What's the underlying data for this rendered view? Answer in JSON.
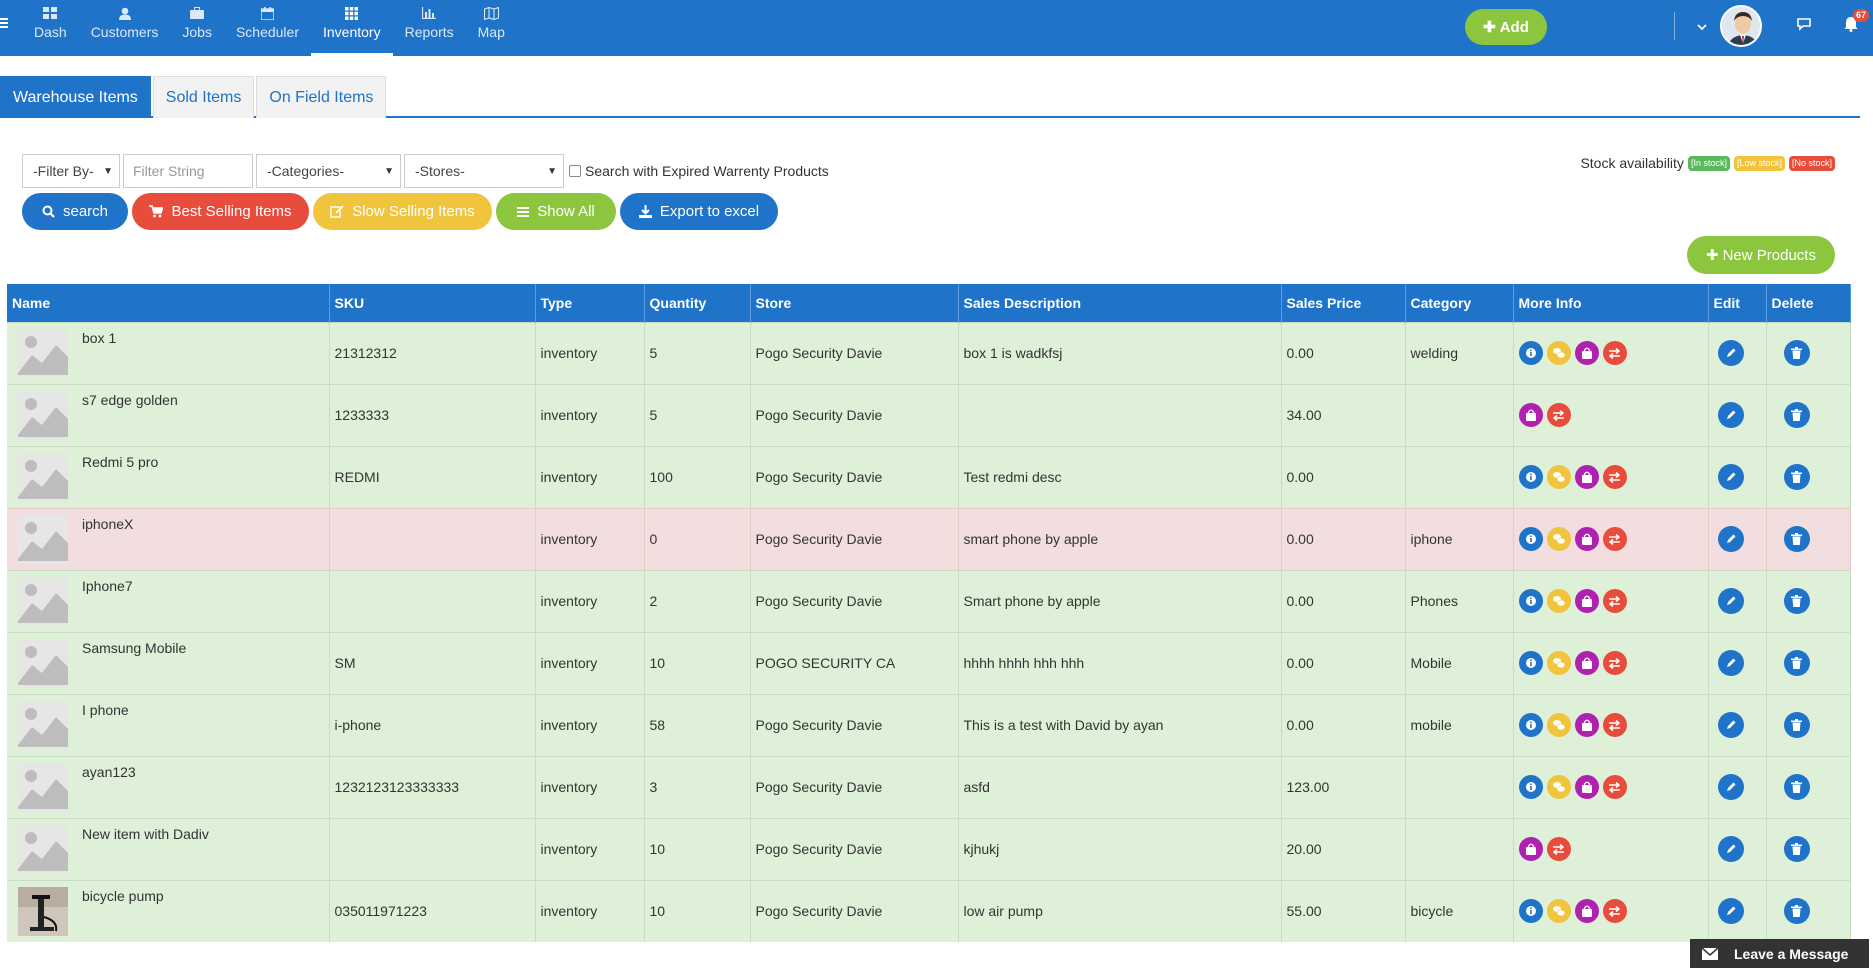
{
  "nav": {
    "items": [
      {
        "label": "Dash",
        "icon": "dashboard-icon",
        "active": false
      },
      {
        "label": "Customers",
        "icon": "user-icon",
        "active": false
      },
      {
        "label": "Jobs",
        "icon": "briefcase-icon",
        "active": false
      },
      {
        "label": "Scheduler",
        "icon": "calendar-icon",
        "active": false
      },
      {
        "label": "Inventory",
        "icon": "grid-icon",
        "active": true
      },
      {
        "label": "Reports",
        "icon": "bar-chart-icon",
        "active": false
      },
      {
        "label": "Map",
        "icon": "map-icon",
        "active": false
      }
    ],
    "add_label": "Add",
    "notification_count": "67"
  },
  "tabs": [
    {
      "label": "Warehouse Items",
      "active": true
    },
    {
      "label": "Sold Items",
      "active": false
    },
    {
      "label": "On Field Items",
      "active": false
    }
  ],
  "filters": {
    "filter_by": "-Filter By-",
    "filter_string_placeholder": "Filter String",
    "categories": "-Categories-",
    "stores": "-Stores-",
    "expired_label": "Search with Expired Warrenty Products"
  },
  "buttons": {
    "search": "search",
    "best_selling": "Best Selling Items",
    "slow_selling": "Slow Selling Items",
    "show_all": "Show All",
    "export": "Export to excel",
    "new_products": "New Products"
  },
  "stock": {
    "label": "Stock availability",
    "in": "[In stock]",
    "low": "[Low stock]",
    "none": "[No stock]"
  },
  "colors": {
    "primary": "#1f73c9",
    "green": "#8cc63f",
    "red": "#e74c3c",
    "yellow": "#f0c43c",
    "purple": "#b021b0",
    "in_stock_row": "#dff0d8",
    "no_stock_row": "#f2dede"
  },
  "table": {
    "headers": [
      "Name",
      "SKU",
      "Type",
      "Quantity",
      "Store",
      "Sales Description",
      "Sales Price",
      "Category",
      "More Info",
      "Edit",
      "Delete"
    ],
    "rows": [
      {
        "name": "box 1",
        "sku": "21312312",
        "type": "inventory",
        "qty": "5",
        "store": "Pogo Security Davie",
        "desc": "box 1 is wadkfsj",
        "price": "0.00",
        "category": "welding",
        "status": "in",
        "full_icons": true,
        "photo": false
      },
      {
        "name": "s7 edge golden",
        "sku": "1233333",
        "type": "inventory",
        "qty": "5",
        "store": "Pogo Security Davie",
        "desc": "",
        "price": "34.00",
        "category": "",
        "status": "in",
        "full_icons": false,
        "photo": false
      },
      {
        "name": "Redmi 5 pro",
        "sku": "REDMI",
        "type": "inventory",
        "qty": "100",
        "store": "Pogo Security Davie",
        "desc": "Test redmi desc",
        "price": "0.00",
        "category": "",
        "status": "in",
        "full_icons": true,
        "photo": false
      },
      {
        "name": "iphoneX",
        "sku": "",
        "type": "inventory",
        "qty": "0",
        "store": "Pogo Security Davie",
        "desc": "smart phone by apple",
        "price": "0.00",
        "category": "iphone",
        "status": "out",
        "full_icons": true,
        "photo": false
      },
      {
        "name": "Iphone7",
        "sku": "",
        "type": "inventory",
        "qty": "2",
        "store": "Pogo Security Davie",
        "desc": "Smart phone by apple",
        "price": "0.00",
        "category": "Phones",
        "status": "in",
        "full_icons": true,
        "photo": false
      },
      {
        "name": "Samsung Mobile",
        "sku": "SM",
        "type": "inventory",
        "qty": "10",
        "store": "POGO SECURITY CA",
        "desc": "hhhh hhhh hhh hhh",
        "price": "0.00",
        "category": "Mobile",
        "status": "in",
        "full_icons": true,
        "photo": false
      },
      {
        "name": "I phone",
        "sku": "i-phone",
        "type": "inventory",
        "qty": "58",
        "store": "Pogo Security Davie",
        "desc": "This is a test with David by ayan",
        "price": "0.00",
        "category": "mobile",
        "status": "in",
        "full_icons": true,
        "photo": false
      },
      {
        "name": "ayan123",
        "sku": "1232123123333333",
        "type": "inventory",
        "qty": "3",
        "store": "Pogo Security Davie",
        "desc": "asfd",
        "price": "123.00",
        "category": "",
        "status": "in",
        "full_icons": true,
        "photo": false
      },
      {
        "name": "New item with Dadiv",
        "sku": "",
        "type": "inventory",
        "qty": "10",
        "store": "Pogo Security Davie",
        "desc": "kjhukj",
        "price": "20.00",
        "category": "",
        "status": "in",
        "full_icons": false,
        "photo": false
      },
      {
        "name": "bicycle pump",
        "sku": "035011971223",
        "type": "inventory",
        "qty": "10",
        "store": "Pogo Security Davie",
        "desc": "low air pump",
        "price": "55.00",
        "category": "bicycle",
        "status": "in",
        "full_icons": true,
        "photo": true
      }
    ]
  },
  "leave_message": "Leave a Message"
}
